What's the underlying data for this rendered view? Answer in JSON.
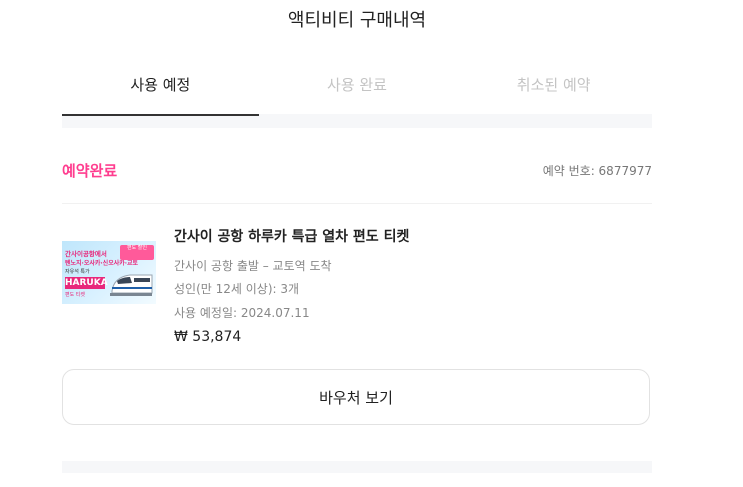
{
  "page": {
    "title": "액티비티 구매내역"
  },
  "tabs": [
    {
      "label": "사용 예정",
      "active": true
    },
    {
      "label": "사용 완료",
      "active": false
    },
    {
      "label": "취소된 예약",
      "active": false
    }
  ],
  "booking": {
    "status": "예약완료",
    "order_number": "예약 번호: 6877977",
    "product": {
      "title": "간사이 공항 하루카 특급 열차 편도 티켓",
      "route": "간사이 공항 출발 – 교토역 도착",
      "quantity": "성인(만 12세 이상): 3개",
      "use_date": "사용 예정일: 2024.07.11",
      "price": "₩ 53,874",
      "thumbnail": {
        "line1": "간사이공항에서",
        "line2": "텐노지·오사카·신오사카·교토",
        "line3": "자유석 특가",
        "badge": "편도 할인",
        "logo": "HARUKA",
        "sub": "편도 티켓"
      }
    },
    "voucher_button": "바우처 보기"
  },
  "colors": {
    "accent": "#ff3d8f",
    "tab_active": "#222222",
    "tab_inactive": "#c4c4c4"
  }
}
